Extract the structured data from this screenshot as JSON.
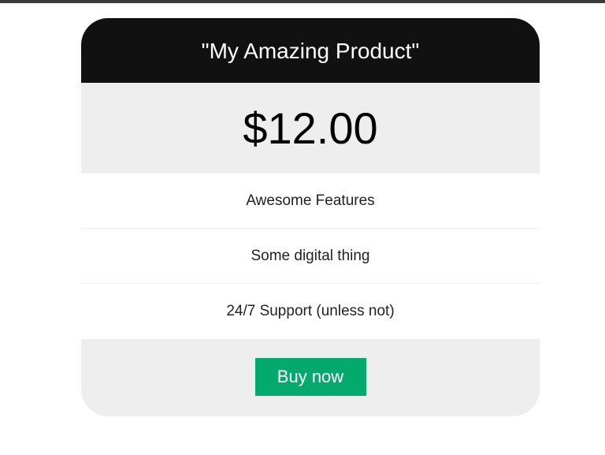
{
  "card": {
    "title": "\"My Amazing Product\"",
    "price": "$12.00",
    "features": [
      "Awesome Features",
      "Some digital thing",
      "24/7 Support (unless not)"
    ],
    "buy_label": "Buy now"
  },
  "colors": {
    "header_bg": "#111111",
    "price_bg": "#eeeeee",
    "button_bg": "#04aa6d"
  }
}
